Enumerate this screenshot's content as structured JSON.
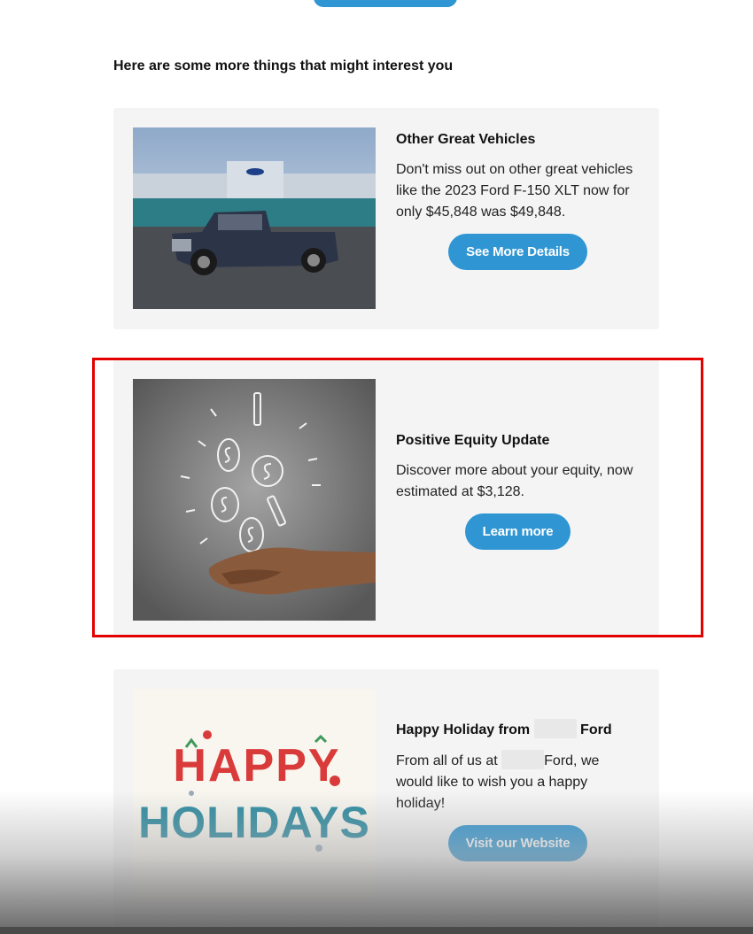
{
  "intro": "Here are some more things that might interest you",
  "cards": [
    {
      "title": "Other Great Vehicles",
      "text": "Don't miss out on other great vehicles like the 2023 Ford F-150 XLT now for only $45,848 was $49,848.",
      "button": "See More Details",
      "image": "ford-truck-at-dealership"
    },
    {
      "title": "Positive Equity Update",
      "text": "Discover more about your equity, now estimated at $3,128.",
      "button": "Learn more",
      "image": "hand-catching-coins"
    },
    {
      "title_before": "Happy Holiday from",
      "title_after": "Ford",
      "text_before": "From all of us at",
      "text_after": "Ford, we would like to wish you a happy holiday!",
      "button": "Visit our Website",
      "image_text_line1": "HAPPY",
      "image_text_line2": "HOLIDAYS"
    }
  ],
  "colors": {
    "button": "#2f96d3",
    "card_bg": "#f4f4f4",
    "highlight": "#e30000"
  }
}
